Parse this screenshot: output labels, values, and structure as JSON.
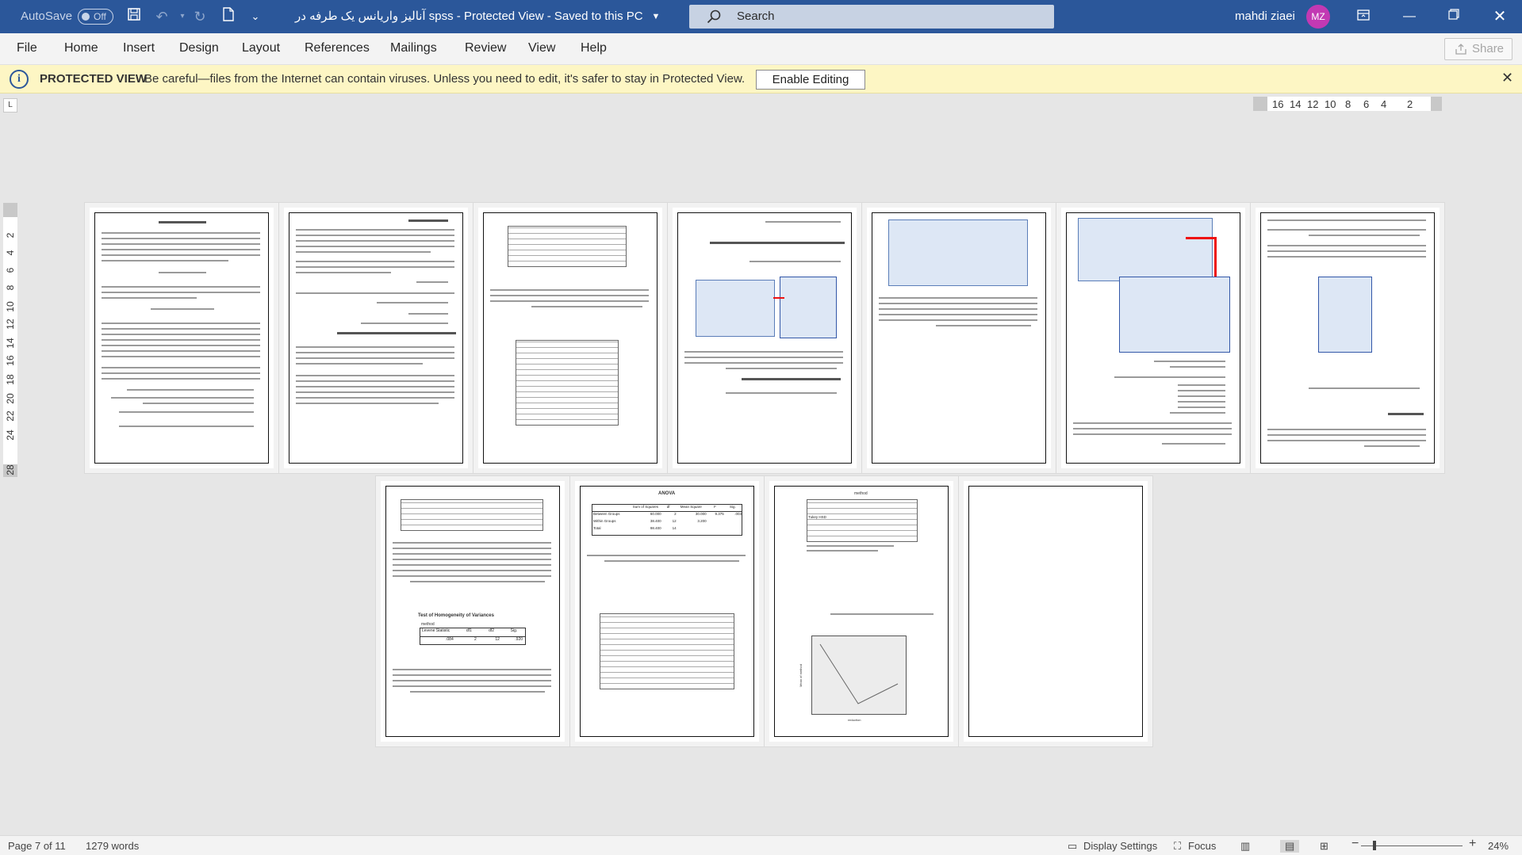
{
  "titlebar": {
    "autosave_label": "AutoSave",
    "autosave_state": "Off",
    "title": "آنالیز واریانس یک طرفه در spss  -  Protected View  -  Saved to this PC",
    "search_placeholder": "Search",
    "user_name": "mahdi ziaei",
    "user_initials": "MZ"
  },
  "menu": {
    "items": [
      "File",
      "Home",
      "Insert",
      "Design",
      "Layout",
      "References",
      "Mailings",
      "Review",
      "View",
      "Help"
    ],
    "share_label": "Share"
  },
  "protected_view": {
    "label": "PROTECTED VIEW",
    "message": "Be careful—files from the Internet can contain viruses. Unless you need to edit, it's safer to stay in Protected View.",
    "enable_button": "Enable Editing"
  },
  "ruler": {
    "h_ticks": [
      "16",
      "14",
      "12",
      "10",
      "8",
      "6",
      "4",
      "2"
    ],
    "v_ticks": [
      "2",
      "4",
      "6",
      "8",
      "10",
      "12",
      "14",
      "16",
      "18",
      "20",
      "22",
      "24",
      "28"
    ]
  },
  "pages": {
    "row1_count": 7,
    "row2_count": 4,
    "page1_heading": "آنالیز واریانس یک طرفه در spss",
    "page2_heading": "مقدمه و تحقیق :",
    "page2_command": "Analyze > Compare means > One-Way ANOVA",
    "page4_command": "Analyze > Descriptive statistics > Explore",
    "page4_levene": "Levene Test -Spread vs Level with",
    "page8_table_title": "Test of Homogeneity of Variances",
    "page8_table_headers": [
      "Levene Statistic",
      "df1",
      "df2",
      "Sig."
    ],
    "page8_table_values": [
      ".084",
      "2",
      "12",
      ".920"
    ],
    "page8_label_method": "method",
    "page9_anova_title": "ANOVA",
    "page9_anova_headers": [
      "",
      "Sum of Squares",
      "df",
      "Mean Square",
      "F",
      "Sig."
    ],
    "page9_anova_rows": [
      [
        "Between Groups",
        "60.000",
        "2",
        "30.000",
        "9.375",
        ".003"
      ],
      [
        "Within Groups",
        "38.400",
        "12",
        "3.200",
        "",
        ""
      ],
      [
        "Total",
        "98.400",
        "14",
        "",
        "",
        ""
      ]
    ],
    "page10_title": "method",
    "page10_subtitle": "Tukey HSD",
    "page10_chart_xlabel": "reduction",
    "page10_chart_ylabel": "Mean of method"
  },
  "statusbar": {
    "page": "Page 7 of 11",
    "words": "1279 words",
    "display_settings": "Display Settings",
    "focus": "Focus",
    "zoom": "24%"
  }
}
